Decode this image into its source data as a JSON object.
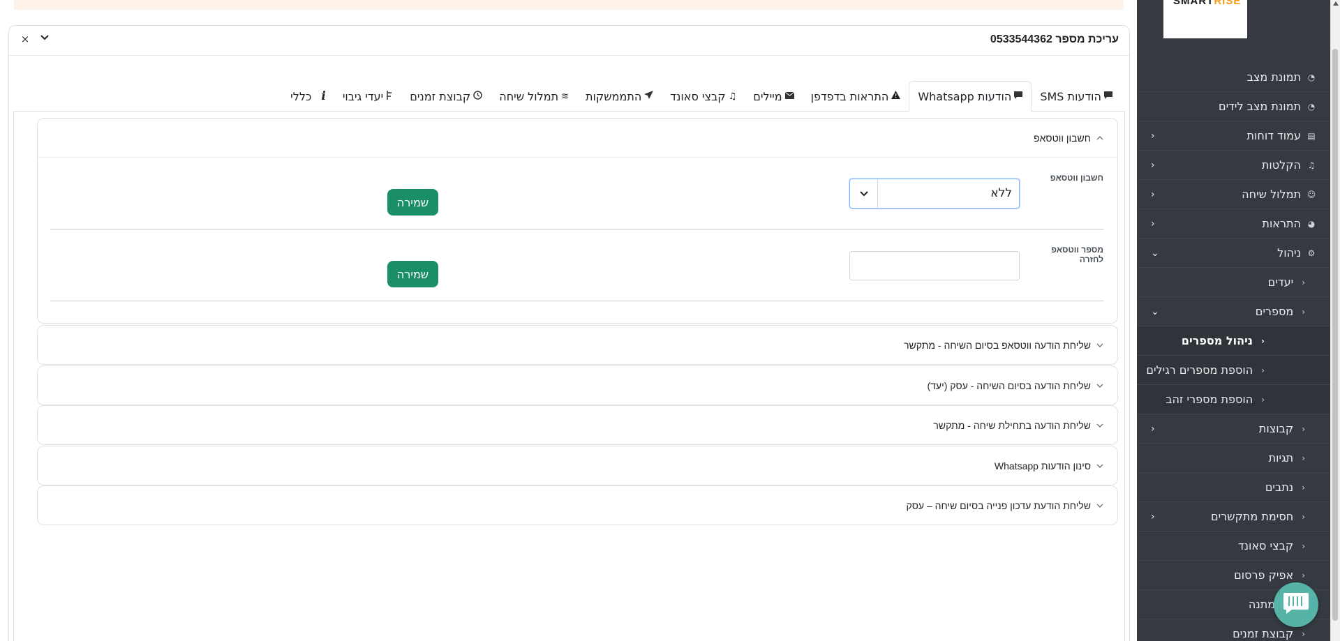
{
  "sidebar": {
    "logo_text": "SMARTRISE",
    "items": [
      {
        "label": "תמונת מצב",
        "icon": "speedometer-icon",
        "chevron": ""
      },
      {
        "label": "תמונת מצב לידים",
        "icon": "speedometer-icon",
        "chevron": ""
      },
      {
        "label": "עמוד דוחות",
        "icon": "document-icon",
        "chevron": "›"
      },
      {
        "label": "הקלטות",
        "icon": "music-note-icon",
        "chevron": "›"
      },
      {
        "label": "תמלול שיחה",
        "icon": "transcription-icon",
        "chevron": "›"
      },
      {
        "label": "התראות",
        "icon": "bell-icon",
        "chevron": "›"
      },
      {
        "label": "ניהול",
        "icon": "gear-icon",
        "chevron": "⌄"
      }
    ],
    "sub_items": [
      {
        "label": "יעדים",
        "chevron": "›"
      },
      {
        "label": "מספרים",
        "chevron": "⌄"
      }
    ],
    "numbers_sub": [
      {
        "label": "ניהול מספרים",
        "active": true
      },
      {
        "label": "הוספת מספרים רגילים",
        "active": false
      },
      {
        "label": "הוספת מספרי זהב",
        "active": false
      }
    ],
    "more_items": [
      {
        "label": "קבוצות",
        "chevron": "›"
      },
      {
        "label": "תגיות",
        "chevron": ""
      },
      {
        "label": "נתבים",
        "chevron": ""
      },
      {
        "label": "חסימת מתקשרים",
        "chevron": "›"
      },
      {
        "label": "קבצי סאונד",
        "chevron": ""
      },
      {
        "label": "אפיק פרסום",
        "chevron": ""
      },
      {
        "label": "ת המתנה",
        "chevron": ""
      },
      {
        "label": "קבוצת זמנים",
        "chevron": ""
      }
    ]
  },
  "modal": {
    "title": "עריכת מספר 0533544362",
    "close_icon": "×",
    "collapse_icon": "⌄"
  },
  "tabs": [
    {
      "label": "הודעות SMS",
      "icon": "sms-icon",
      "glyph": "▀"
    },
    {
      "label": "הודעות Whatsapp",
      "icon": "chat-icon",
      "glyph": "▀",
      "active": true
    },
    {
      "label": "התראות בדפדפן",
      "icon": "warning-icon",
      "glyph": "▲"
    },
    {
      "label": "מיילים",
      "icon": "envelope-icon",
      "glyph": "✉"
    },
    {
      "label": "קבצי סאונד",
      "icon": "music-note-icon",
      "glyph": "♫"
    },
    {
      "label": "התממשקות",
      "icon": "send-icon",
      "glyph": "➤"
    },
    {
      "label": "תמלול שיחה",
      "icon": "waves-icon",
      "glyph": "≋"
    },
    {
      "label": "קבוצת זמנים",
      "icon": "clock-icon",
      "glyph": "◷"
    },
    {
      "label": "יעדי גיבוי",
      "icon": "route-icon",
      "glyph": "ɛ"
    },
    {
      "label": "כללי",
      "icon": "info-icon",
      "glyph": "i"
    }
  ],
  "whatsapp_account": {
    "header": "חשבון ווטסאפ",
    "account_label": "חשבון ווטסאפ",
    "account_value": "ללא",
    "return_label": "מספר ווטסאפ לחזרה",
    "return_value": "",
    "save_label": "שמירה"
  },
  "accordions": [
    "שליחת הודעה ווטסאפ בסיום השיחה - מתקשר",
    "שליחת הודעה בסיום השיחה - עסק (יעד)",
    "שליחת הודעה בתחילת שיחה - מתקשר",
    "סינון הודעות Whatsapp",
    "שליחת הודעת עדכון פנייה בסיום שיחה – עסק"
  ]
}
